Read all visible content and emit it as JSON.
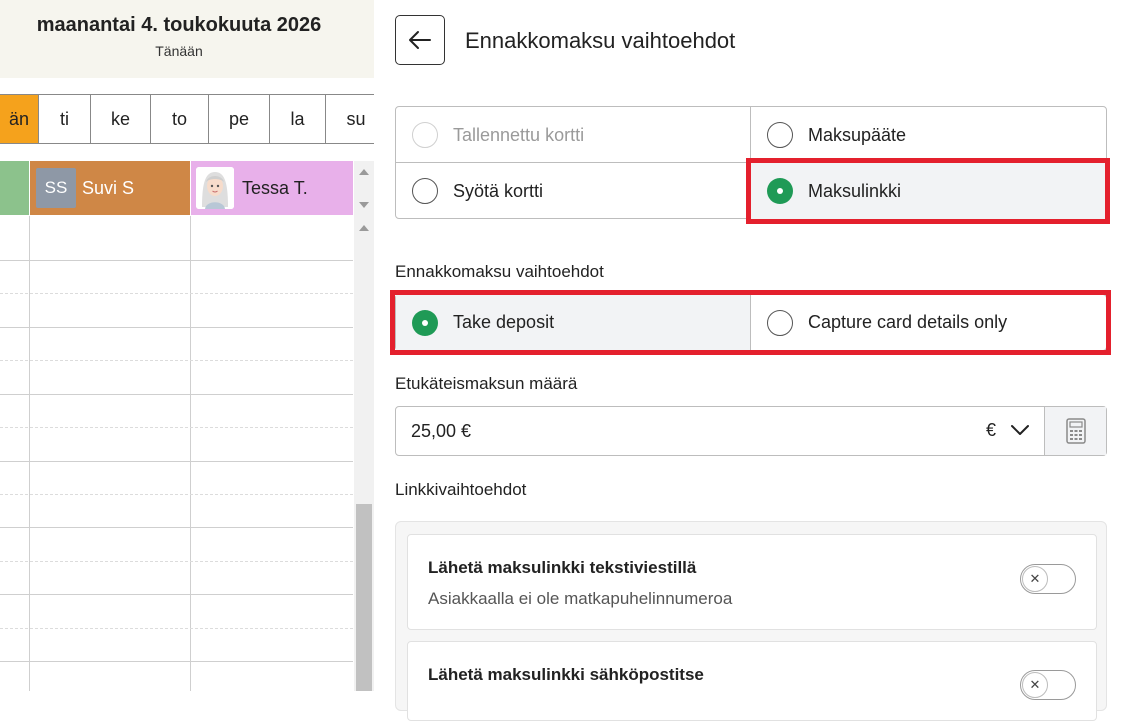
{
  "calendar": {
    "date_title": "maanantai 4. toukokuuta 2026",
    "date_sub": "Tänään",
    "days": [
      "än",
      "ti",
      "ke",
      "to",
      "pe",
      "la",
      "su"
    ],
    "staff": [
      {
        "initials": "SS",
        "name": "Suvi S"
      },
      {
        "name": "Tessa T."
      }
    ]
  },
  "panel": {
    "title": "Ennakkomaksu vaihtoehdot",
    "payment_methods": [
      {
        "label": "Tallennettu kortti",
        "state": "disabled"
      },
      {
        "label": "Maksupääte",
        "state": "unselected"
      },
      {
        "label": "Syötä kortti",
        "state": "unselected"
      },
      {
        "label": "Maksulinkki",
        "state": "selected"
      }
    ],
    "deposit_section_label": "Ennakkomaksu vaihtoehdot",
    "deposit_options": [
      {
        "label": "Take deposit",
        "state": "selected"
      },
      {
        "label": "Capture card details only",
        "state": "unselected"
      }
    ],
    "amount_label": "Etukäteismaksun määrä",
    "amount_value": "25,00 €",
    "currency": "€",
    "link_section_label": "Linkkivaihtoehdot",
    "link_options": [
      {
        "title": "Lähetä maksulinkki tekstiviestillä",
        "subtitle": "Asiakkaalla ei ole matkapuhelinnumeroa",
        "enabled": false
      },
      {
        "title": "Lähetä maksulinkki sähköpostitse",
        "enabled": false
      }
    ]
  },
  "colors": {
    "accent_green": "#1f9a56",
    "highlight_red": "#e4202d",
    "today_orange": "#f5a21c"
  },
  "icons": [
    "arrow-left-icon",
    "chevron-down-icon",
    "calculator-icon",
    "close-icon",
    "scroll-up-arrow-icon",
    "scroll-down-arrow-icon"
  ]
}
